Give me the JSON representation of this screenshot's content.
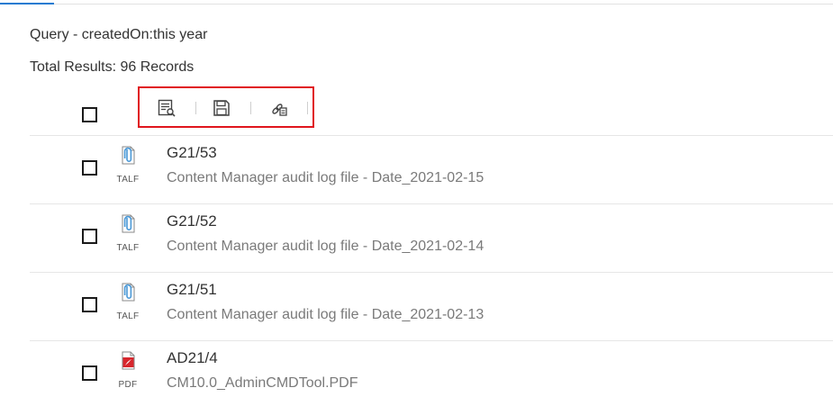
{
  "query": {
    "label": "Query - createdOn:this year"
  },
  "summary": {
    "total_results": "Total Results: 96 Records"
  },
  "toolbar": {
    "buttons": [
      {
        "icon": "view-details-icon"
      },
      {
        "icon": "save-icon"
      },
      {
        "icon": "attach-to-record-icon"
      }
    ],
    "highlight_color": "#e0151d"
  },
  "records": [
    {
      "number": "G21/53",
      "title": "Content Manager audit log file - Date_2021-02-15",
      "ext": "TALF",
      "icon": "paperclip-document-icon"
    },
    {
      "number": "G21/52",
      "title": "Content Manager audit log file - Date_2021-02-14",
      "ext": "TALF",
      "icon": "paperclip-document-icon"
    },
    {
      "number": "G21/51",
      "title": "Content Manager audit log file - Date_2021-02-13",
      "ext": "TALF",
      "icon": "paperclip-document-icon"
    },
    {
      "number": "AD21/4",
      "title": "CM10.0_AdminCMDTool.PDF",
      "ext": "PDF",
      "icon": "pdf-document-icon"
    }
  ],
  "colors": {
    "accent": "#1f7bd1",
    "pdf_red": "#d7262d",
    "clip_blue": "#4a98d6"
  }
}
